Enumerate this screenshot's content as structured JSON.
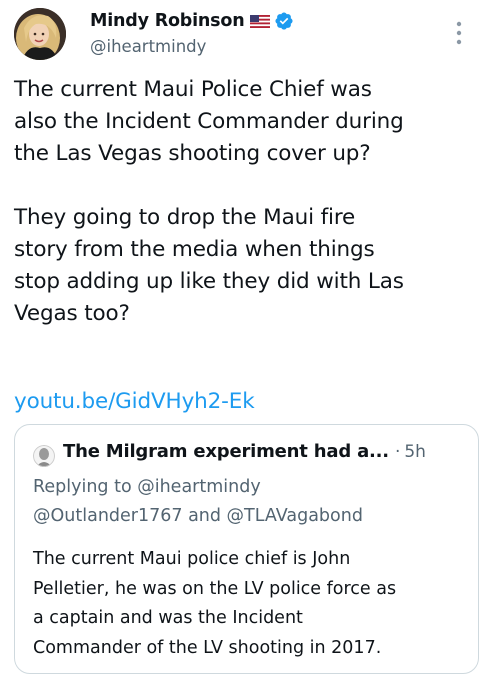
{
  "author": {
    "name": "Mindy Robinson",
    "handle": "@iheartmindy",
    "flag_icon": "us-flag-icon",
    "verified_icon": "verified-badge-icon",
    "verified_color": "#1d9bf0"
  },
  "tweet": {
    "paragraphs": [
      [
        "The current Maui Police Chief was",
        "also the Incident Commander during",
        "the Las Vegas shooting cover up?"
      ],
      [
        "They going to drop the Maui fire",
        "story from the media when things",
        "stop adding up like they did with Las",
        "Vegas too?"
      ]
    ],
    "link": "youtu.be/GidVHyh2-Ek",
    "link_color": "#1d9bf0"
  },
  "quote": {
    "name": "The Milgram experiment had a...",
    "separator": "·",
    "time": "5h",
    "replying_lines": [
      "Replying to @iheartmindy",
      "@Outlander1767 and @TLAVagabond"
    ],
    "text_lines": [
      "The current Maui police chief is John",
      "Pelletier, he was on the LV police force as",
      "a captain and was the Incident",
      "Commander of the LV shooting in 2017."
    ]
  },
  "icons": {
    "more": "more-vertical-icon"
  }
}
